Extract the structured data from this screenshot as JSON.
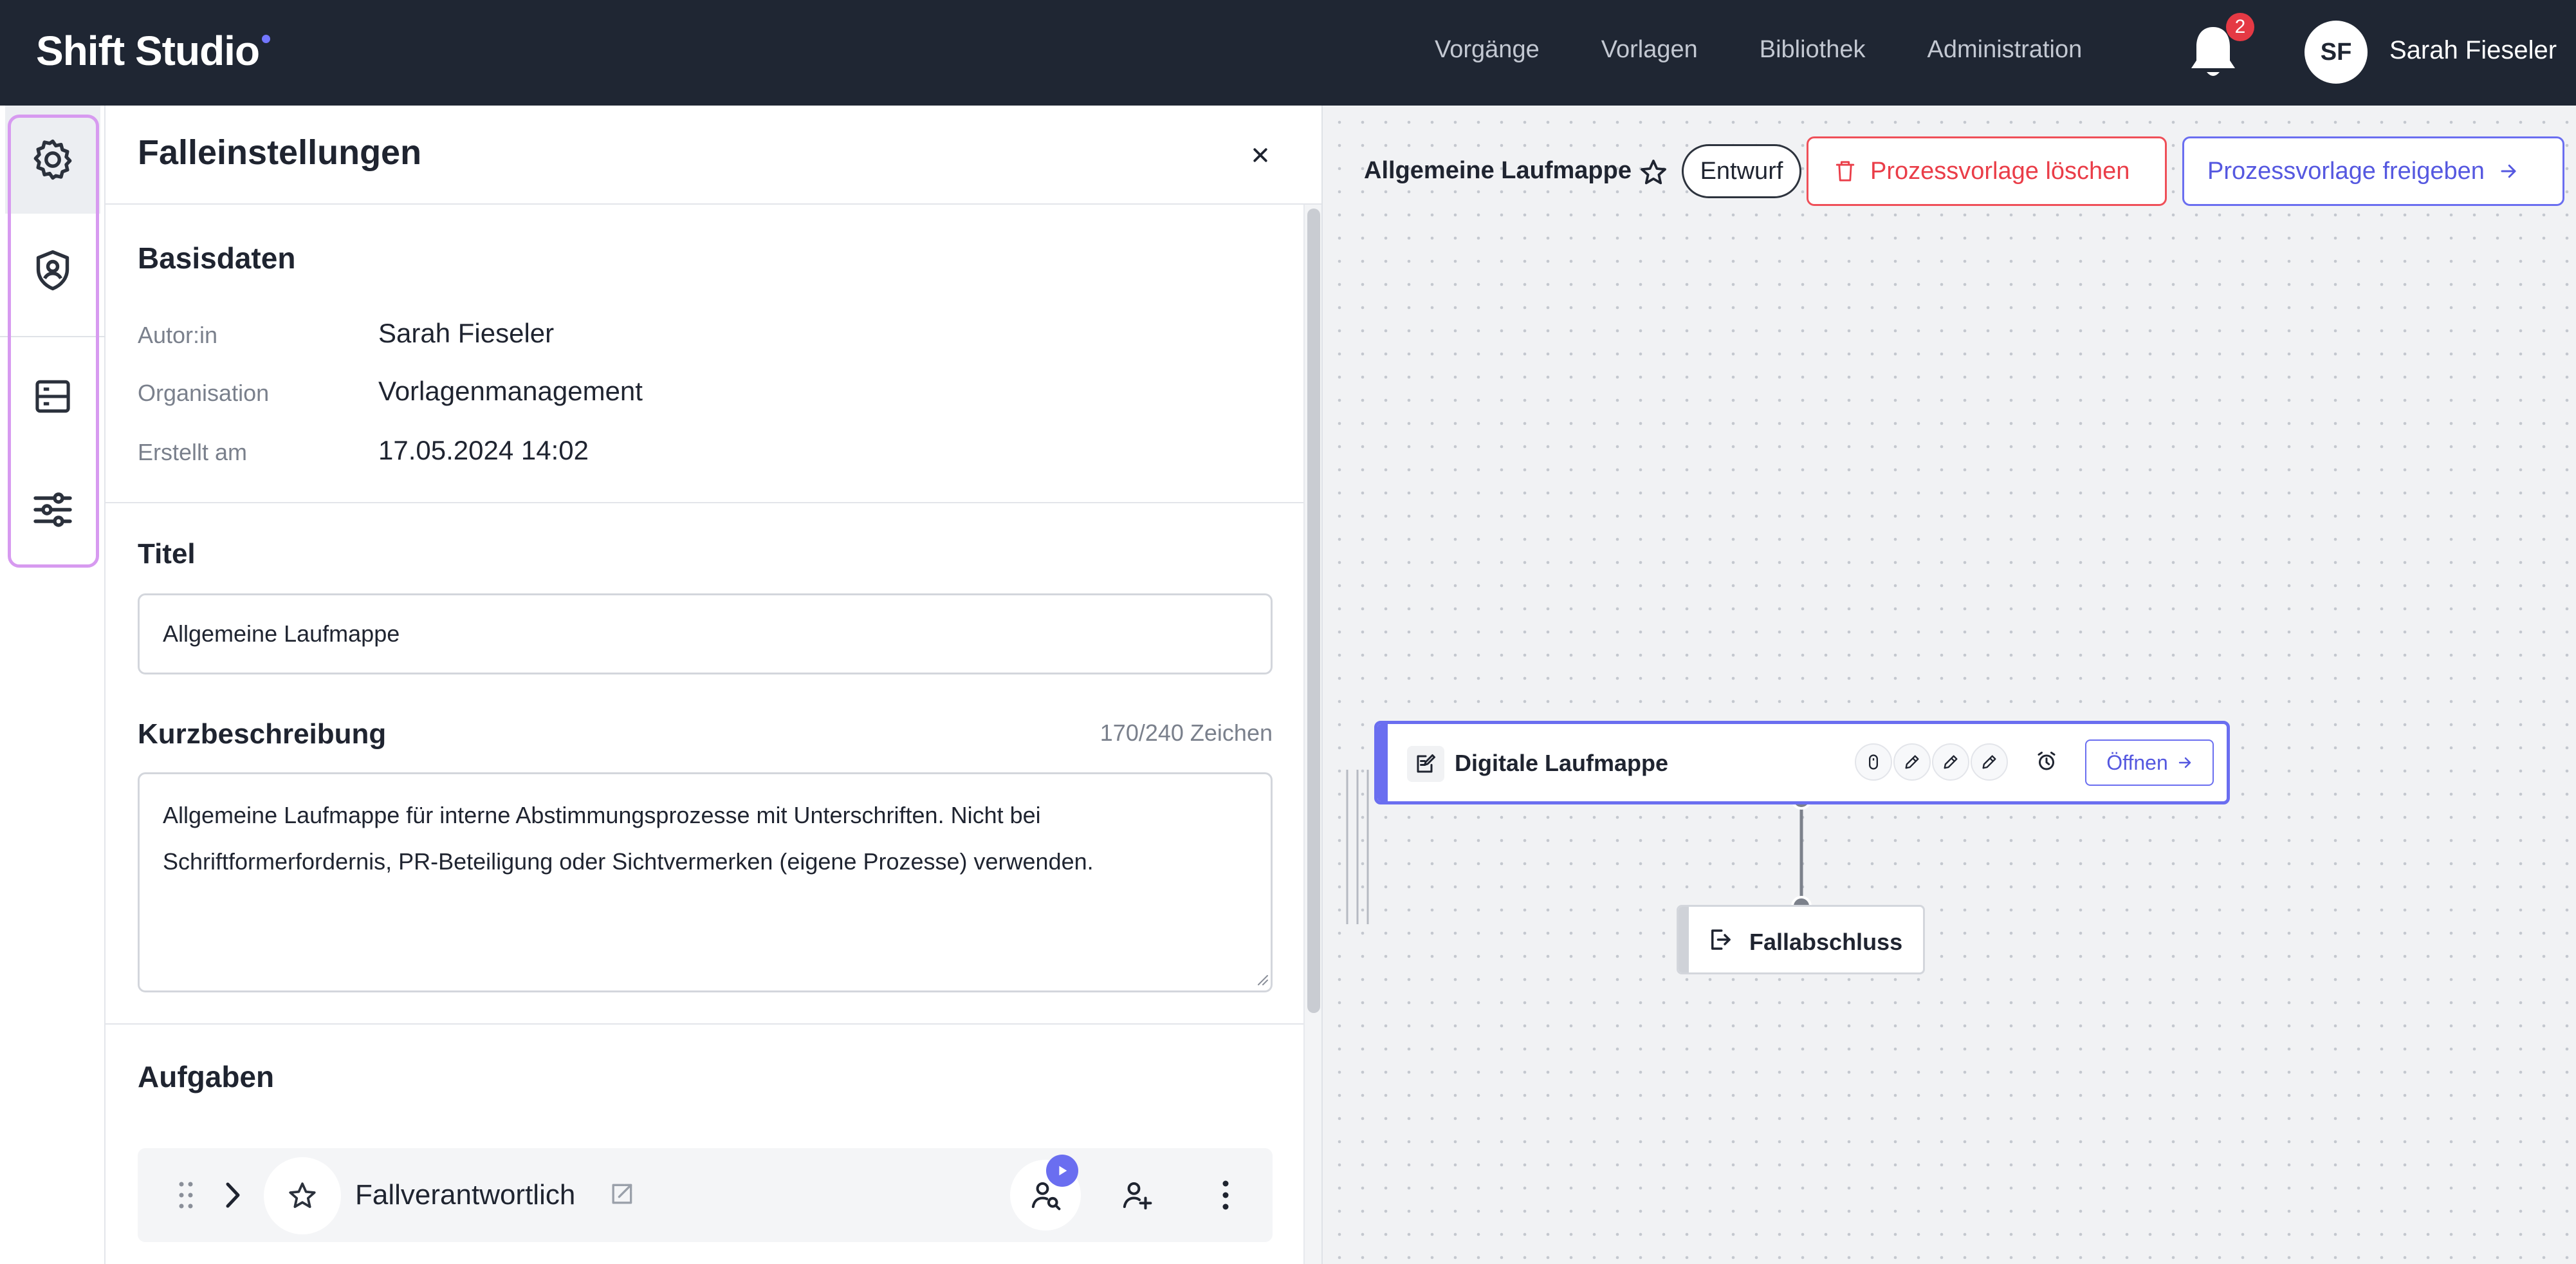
{
  "app": {
    "logo_text": "Shift Studio",
    "accent_color": "#6a6ef0"
  },
  "topbar": {
    "nav": [
      "Vorgänge",
      "Vorlagen",
      "Bibliothek",
      "Administration"
    ],
    "notification_count": "2",
    "avatar_initials": "SF",
    "user_name": "Sarah Fieseler"
  },
  "rail": {
    "items": [
      {
        "icon": "gear-icon",
        "active": true
      },
      {
        "icon": "user-shield-icon",
        "active": false
      },
      {
        "icon": "server-icon",
        "active": false
      },
      {
        "icon": "sliders-icon",
        "active": false
      }
    ]
  },
  "panel": {
    "title": "Falleinstellungen",
    "basis": {
      "heading": "Basisdaten",
      "rows": [
        {
          "label": "Autor:in",
          "value": "Sarah Fieseler"
        },
        {
          "label": "Organisation",
          "value": "Vorlagenmanagement"
        },
        {
          "label": "Erstellt am",
          "value": "17.05.2024 14:02"
        }
      ]
    },
    "title_field": {
      "label": "Titel",
      "value": "Allgemeine Laufmappe"
    },
    "description_field": {
      "label": "Kurzbeschreibung",
      "counter": "170/240 Zeichen",
      "value": "Allgemeine Laufmappe für interne Abstimmungsprozesse mit Unterschriften. Nicht bei Schriftformerfordernis, PR-Beteiligung oder Sichtvermerken (eigene Prozesse) verwenden."
    },
    "tasks": {
      "heading": "Aufgaben",
      "items": [
        {
          "title": "Fallverantwortlich"
        }
      ]
    }
  },
  "canvas": {
    "process_title": "Allgemeine Laufmappe",
    "status_pill": "Entwurf",
    "delete_label": "Prozessvorlage löschen",
    "release_label": "Prozessvorlage freigeben",
    "nodes": {
      "main_title": "Digitale Laufmappe",
      "open_label": "Öffnen",
      "end_title": "Fallabschluss"
    }
  }
}
